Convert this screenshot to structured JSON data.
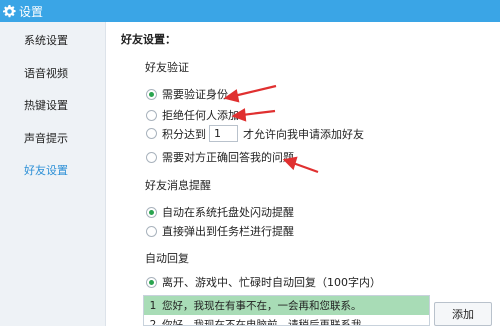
{
  "window": {
    "title": "设置",
    "gear_icon": "gear-icon"
  },
  "sidebar": {
    "items": [
      {
        "label": "系统设置",
        "active": false
      },
      {
        "label": "语音视频",
        "active": false
      },
      {
        "label": "热键设置",
        "active": false
      },
      {
        "label": "声音提示",
        "active": false
      },
      {
        "label": "好友设置",
        "active": true
      }
    ]
  },
  "friend_settings": {
    "title": "好友设置：",
    "verify": {
      "title": "好友验证",
      "options": [
        {
          "label": "需要验证身份",
          "selected": true
        },
        {
          "label": "拒绝任何人添加",
          "selected": false
        },
        {
          "label_pre": "积分达到",
          "value": "1",
          "label_post": "才允许向我申请添加好友",
          "selected": false
        },
        {
          "label": "需要对方正确回答我的问题",
          "selected": false
        }
      ]
    },
    "message_remind": {
      "title": "好友消息提醒",
      "options": [
        {
          "label": "自动在系统托盘处闪动提醒",
          "selected": true
        },
        {
          "label": "直接弹出到任务栏进行提醒",
          "selected": false
        }
      ]
    },
    "auto_reply": {
      "title": "自动回复",
      "option": {
        "label": "离开、游戏中、忙碌时自动回复（100字内）",
        "selected": true
      },
      "list": [
        {
          "index": "1",
          "text": "您好，我现在有事不在，一会再和您联系。"
        },
        {
          "index": "2",
          "text": "你好，我现在不在电脑前，请稍后再联系我..."
        }
      ],
      "add_label": "添加"
    }
  },
  "colors": {
    "titlebar": "#3aa5e6",
    "accent": "#2b8fd6",
    "radio_on": "#2aa44f",
    "arrow": "#e03030",
    "selected_row": "#a8dcb6"
  }
}
